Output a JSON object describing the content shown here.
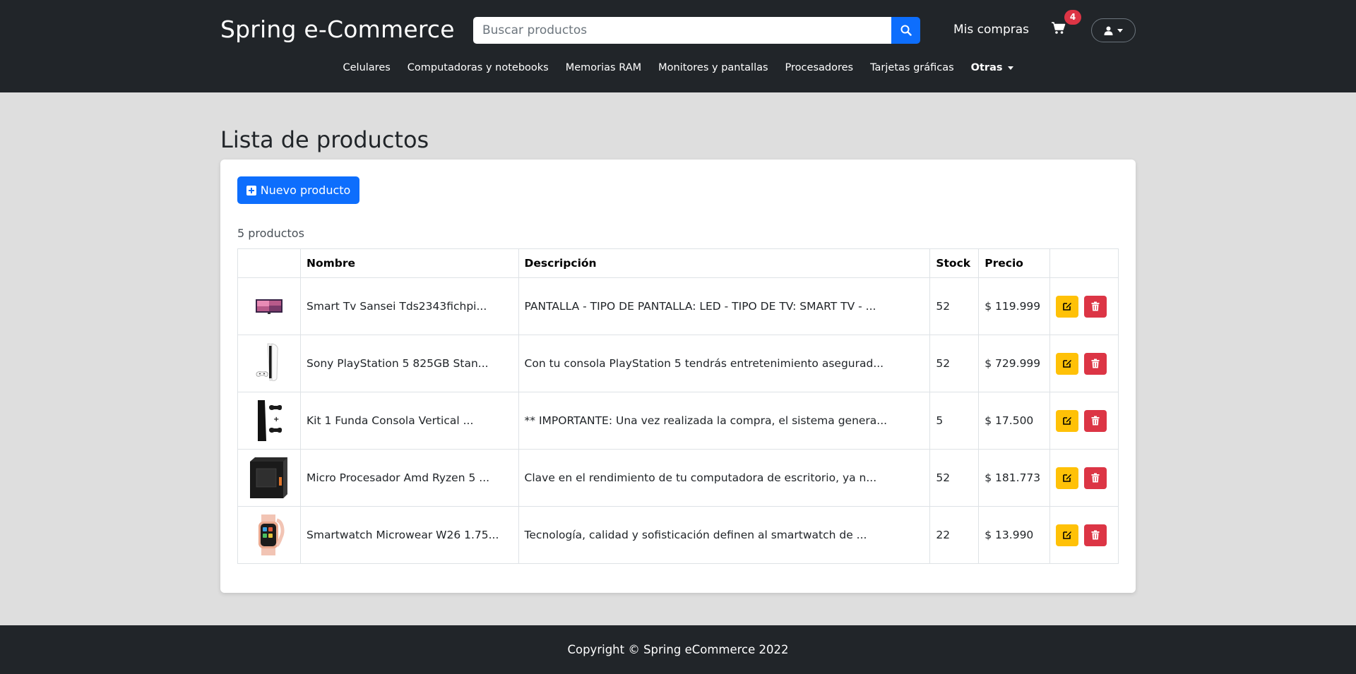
{
  "header": {
    "brand": "Spring e-Commerce",
    "search_placeholder": "Buscar productos",
    "mis_compras": "Mis compras",
    "cart_count": "4",
    "categories": [
      "Celulares",
      "Computadoras y notebooks",
      "Memorias RAM",
      "Monitores y pantallas",
      "Procesadores",
      "Tarjetas gráficas"
    ],
    "more_label": "Otras"
  },
  "main": {
    "title": "Lista de productos",
    "new_button": "Nuevo producto",
    "count_text": "5 productos",
    "table": {
      "headers": [
        "",
        "Nombre",
        "Descripción",
        "Stock",
        "Precio",
        ""
      ],
      "rows": [
        {
          "image": "tv-image",
          "name": "Smart Tv Sansei Tds2343fichpi...",
          "description": "PANTALLA - TIPO DE PANTALLA: LED - TIPO DE TV: SMART TV - ...",
          "stock": "52",
          "price": "$ 119.999"
        },
        {
          "image": "playstation-image",
          "name": "Sony PlayStation 5 825GB Stan...",
          "description": "Con tu consola PlayStation 5 tendrás entretenimiento asegurad...",
          "stock": "52",
          "price": "$ 729.999"
        },
        {
          "image": "console-case-image",
          "name": "Kit 1 Funda Consola Vertical ...",
          "description": "** IMPORTANTE: Una vez realizada la compra, el sistema genera...",
          "stock": "5",
          "price": "$ 17.500"
        },
        {
          "image": "processor-box-image",
          "name": "Micro Procesador Amd Ryzen 5 ...",
          "description": "Clave en el rendimiento de tu computadora de escritorio, ya n...",
          "stock": "52",
          "price": "$ 181.773"
        },
        {
          "image": "smartwatch-image",
          "name": "Smartwatch Microwear W26 1.75...",
          "description": "Tecnología, calidad y sofisticación definen al smartwatch de ...",
          "stock": "22",
          "price": "$ 13.990"
        }
      ]
    }
  },
  "footer": {
    "copyright": "Copyright © Spring eCommerce 2022"
  },
  "colors": {
    "navbar": "#212529",
    "primary": "#0d6efd",
    "warning": "#ffc107",
    "danger": "#dc3545",
    "page_bg": "#dedede"
  },
  "icons": {
    "search": "search-icon",
    "cart": "cart-icon",
    "user": "user-icon",
    "add": "plus-square-icon",
    "edit": "edit-icon",
    "delete": "trash-icon"
  }
}
